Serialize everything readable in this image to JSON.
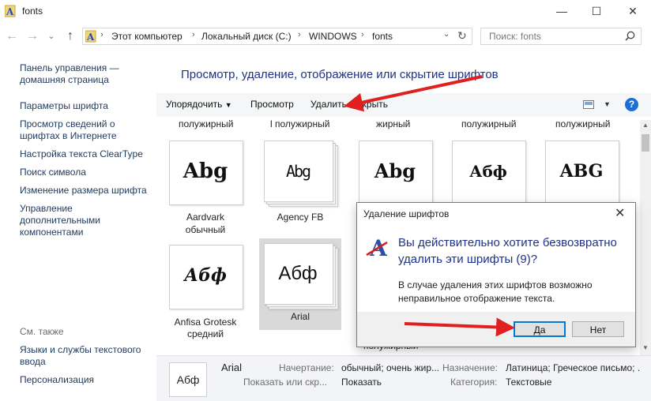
{
  "window": {
    "title": "fonts",
    "min_glyph": "—",
    "max_glyph": "☐",
    "close_glyph": "✕"
  },
  "address": {
    "breadcrumbs": [
      "Этот компьютер",
      "Локальный диск (C:)",
      "WINDOWS",
      "fonts"
    ],
    "separator": "›",
    "back_glyph": "←",
    "forward_glyph": "→",
    "down_glyph": "⌄",
    "up_glyph": "↑",
    "refresh_glyph": "↻",
    "dropdown_glyph": "⌄"
  },
  "search": {
    "placeholder": "Поиск: fonts"
  },
  "sidebar": {
    "items": [
      "Панель управления — домашняя страница",
      "Параметры шрифта",
      "Просмотр сведений о шрифтах в Интернете",
      "Настройка текста ClearType",
      "Поиск символа",
      "Изменение размера шрифта",
      "Управление дополнительными компонентами"
    ],
    "see_also_title": "См. также",
    "see_also": [
      "Языки и службы текстового ввода",
      "Персонализация"
    ]
  },
  "main": {
    "title": "Просмотр, удаление, отображение или скрытие шрифтов",
    "toolbar": {
      "organize": "Упорядочить",
      "preview": "Просмотр",
      "delete": "Удалить",
      "hide": "Скрыть",
      "help": "?"
    },
    "top_partial_captions": [
      "полужирный",
      "l полужирный",
      "жирный",
      "полужирный",
      "полужирный"
    ],
    "tiles": [
      {
        "glyph": "Abg",
        "name1": "Aardvark",
        "name2": "обычный"
      },
      {
        "glyph": "Abg",
        "name1": "Agency FB",
        "name2": ""
      },
      {
        "glyph": "Abg",
        "name1": "",
        "name2": ""
      },
      {
        "glyph": "Абф",
        "name1": "",
        "name2": ""
      },
      {
        "glyph": "ABG",
        "name1": "",
        "name2": ""
      },
      {
        "glyph": "Абф",
        "name1": "Anfisa Grotesk",
        "name2": "средний"
      },
      {
        "glyph": "Абф",
        "name1": "Arial",
        "name2": ""
      }
    ],
    "bottom_partial_caption": "полужирный"
  },
  "details": {
    "preview_glyph": "Абф",
    "font_name": "Arial",
    "show_or_hide": "Показать или скр...",
    "style_label": "Начертание:",
    "style_value": "обычный; очень жир...",
    "show_label": "Показать",
    "purpose_label": "Назначение:",
    "purpose_value": "Латиница; Греческое письмо; ...",
    "category_label": "Категория:",
    "category_value": "Текстовые"
  },
  "dialog": {
    "title": "Удаление шрифтов",
    "question": "Вы действительно хотите безвозвратно удалить эти шрифты (9)?",
    "message": "В случае удаления этих шрифтов возможно неправильное отображение текста.",
    "yes": "Да",
    "no": "Нет"
  },
  "colors": {
    "link": "#1e395b",
    "title_blue": "#1e3287",
    "annotation_red": "#e02020",
    "default_button_border": "#0078d7"
  }
}
